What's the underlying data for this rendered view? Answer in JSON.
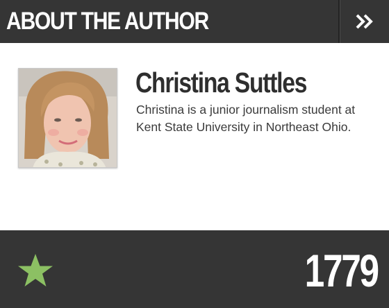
{
  "header": {
    "title": "ABOUT THE AUTHOR",
    "next_icon": "double-chevron-right-icon"
  },
  "author": {
    "name": "Christina Suttles",
    "bio": "Christina is a junior journalism student at Kent State University in Northeast Ohio.",
    "photo_icon": "author-photo"
  },
  "footer": {
    "star_icon": "star-icon",
    "count": "1779"
  },
  "colors": {
    "header_bg": "#353535",
    "footer_bg": "#353535",
    "star": "#8cc063",
    "name_text": "#2e2e2e",
    "body_text": "#3a3a3a"
  }
}
